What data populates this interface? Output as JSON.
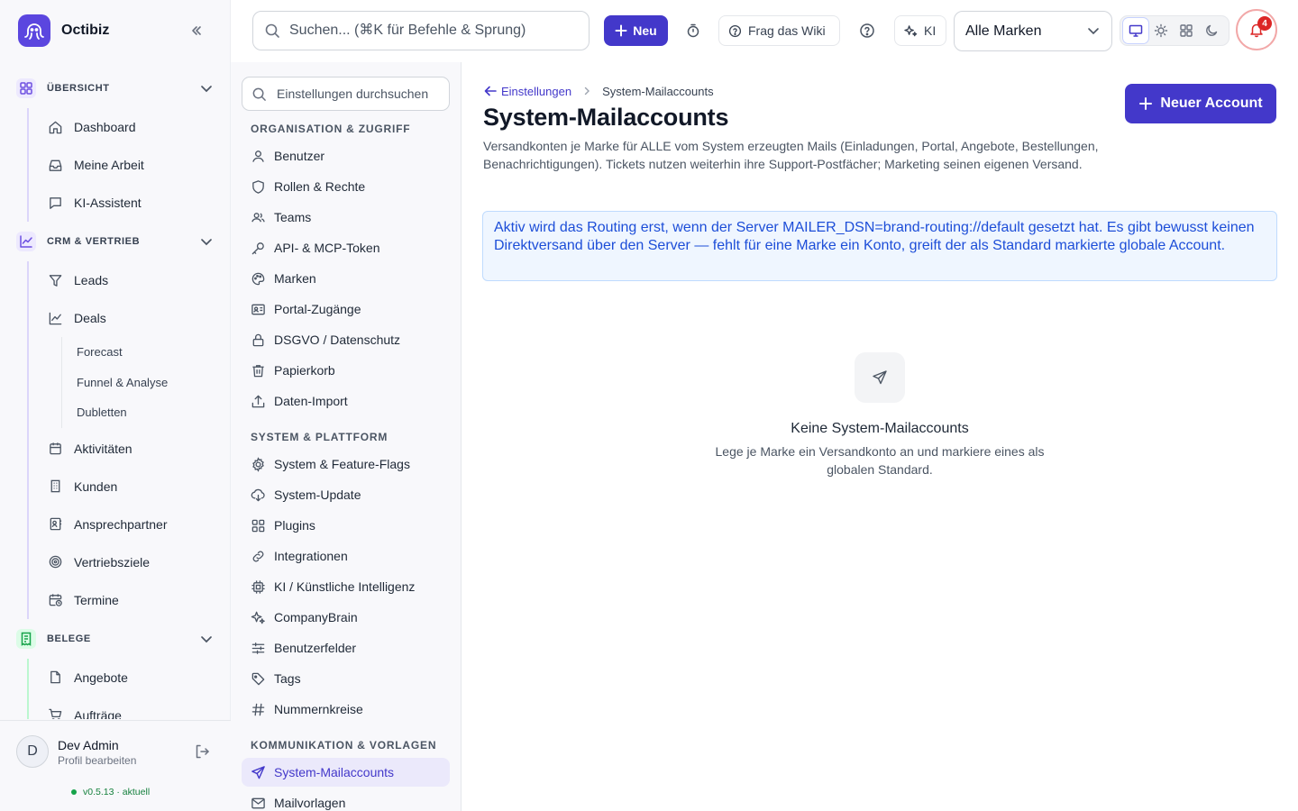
{
  "app": {
    "name": "Octibiz",
    "version": "v0.5.13",
    "version_status": "aktuell"
  },
  "topbar": {
    "search_placeholder": "Suchen... (⌘K für Befehle & Sprung)",
    "new_label": "Neu",
    "wiki_label": "Frag das Wiki",
    "ai_label": "KI",
    "brand_select": "Alle Marken",
    "notification_count": "4"
  },
  "sidebar": {
    "groups": [
      {
        "label": "ÜBERSICHT",
        "items": [
          "Dashboard",
          "Meine Arbeit",
          "KI-Assistent"
        ]
      },
      {
        "label": "CRM & VERTRIEB",
        "items": [
          "Leads",
          "Deals"
        ],
        "subitems": [
          "Forecast",
          "Funnel & Analyse",
          "Dubletten"
        ],
        "items_after": [
          "Aktivitäten",
          "Kunden",
          "Ansprechpartner",
          "Vertriebsziele",
          "Termine"
        ]
      },
      {
        "label": "BELEGE",
        "items": [
          "Angebote",
          "Aufträge"
        ]
      }
    ]
  },
  "user": {
    "initial": "D",
    "name": "Dev Admin",
    "sub": "Profil bearbeiten"
  },
  "settings": {
    "search_placeholder": "Einstellungen durchsuchen",
    "sections": [
      "ORGANISATION & ZUGRIFF",
      "SYSTEM & PLATTFORM",
      "KOMMUNIKATION & VORLAGEN"
    ],
    "org_items": [
      "Benutzer",
      "Rollen & Rechte",
      "Teams",
      "API- & MCP-Token",
      "Marken",
      "Portal-Zugänge",
      "DSGVO / Datenschutz",
      "Papierkorb",
      "Daten-Import"
    ],
    "system_items": [
      "System & Feature-Flags",
      "System-Update",
      "Plugins",
      "Integrationen",
      "KI / Künstliche Intelligenz",
      "CompanyBrain",
      "Benutzerfelder",
      "Tags",
      "Nummernkreise"
    ],
    "comm_items": [
      "System-Mailaccounts",
      "Mailvorlagen"
    ]
  },
  "main": {
    "breadcrumb_parent": "Einstellungen",
    "breadcrumb_current": "System-Mailaccounts",
    "title": "System-Mailaccounts",
    "description": "Versandkonten je Marke für ALLE vom System erzeugten Mails (Einladungen, Portal, Angebote, Bestellungen, Benachrichtigungen). Tickets nutzen weiterhin ihre Support-Postfächer; Marketing seinen eigenen Versand.",
    "primary_button": "Neuer Account",
    "info": "Aktiv wird das Routing erst, wenn der Server MAILER_DSN=brand-routing://default gesetzt hat. Es gibt bewusst keinen Direktversand über den Server — fehlt für eine Marke ein Konto, greift der als Standard markierte globale Account.",
    "empty_title": "Keine System-Mailaccounts",
    "empty_text": "Lege je Marke ein Versandkonto an und markiere eines als globalen Standard."
  },
  "colors": {
    "accent": "#4338ca",
    "info_bg": "#eff6ff",
    "info_text": "#1d4ed8",
    "badge": "#dc2626"
  }
}
